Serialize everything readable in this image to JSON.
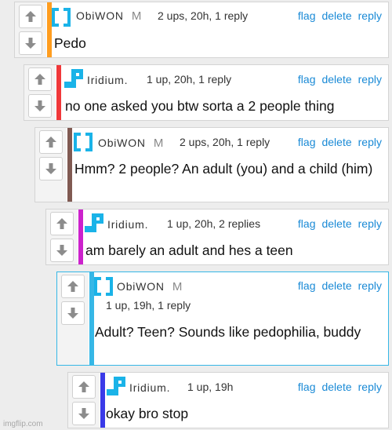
{
  "comments": [
    {
      "user": "ObiWON",
      "badge": "M",
      "meta": "2 ups, 20h, 1 reply",
      "text": "Pedo",
      "bar_color": "#ff9d1f",
      "avatar_icon": "square-bracket-avatar-icon",
      "actions": {
        "flag": "flag",
        "delete": "delete",
        "reply": "reply"
      }
    },
    {
      "user": "Iridium.",
      "meta": "1 up, 20h, 1 reply",
      "text": "no one asked you btw sorta a 2 people thing",
      "bar_color": "#f0383a",
      "avatar_icon": "stair-step-avatar-icon",
      "actions": {
        "flag": "flag",
        "delete": "delete",
        "reply": "reply"
      }
    },
    {
      "user": "ObiWON",
      "badge": "M",
      "meta": "2 ups, 20h, 1 reply",
      "text": "Hmm? 2 people? An adult (you) and a child (him)",
      "bar_color": "#805a52",
      "avatar_icon": "square-bracket-avatar-icon",
      "actions": {
        "flag": "flag",
        "delete": "delete",
        "reply": "reply"
      }
    },
    {
      "user": "Iridium.",
      "meta": "1 up, 20h, 2 replies",
      "text": "am barely an adult and hes a teen",
      "bar_color": "#cc22cc",
      "avatar_icon": "stair-step-avatar-icon",
      "actions": {
        "flag": "flag",
        "delete": "delete",
        "reply": "reply"
      }
    },
    {
      "user": "ObiWON",
      "badge": "M",
      "meta": "1 up, 19h, 1 reply",
      "text": "Adult? Teen? Sounds like pedophilia, buddy",
      "bar_color": "#36b7e6",
      "avatar_icon": "square-bracket-avatar-icon",
      "actions": {
        "flag": "flag",
        "delete": "delete",
        "reply": "reply"
      }
    },
    {
      "user": "Iridium.",
      "meta": "1 up, 19h",
      "text": "okay bro stop",
      "bar_color": "#3a3ae8",
      "avatar_icon": "stair-step-avatar-icon",
      "actions": {
        "flag": "flag",
        "delete": "delete",
        "reply": "reply"
      }
    }
  ],
  "colors": {
    "link": "#1a8ad6",
    "avatar": "#1ab3e8",
    "highlight_border": "#36b7e6"
  },
  "watermark": "imgflip.com"
}
